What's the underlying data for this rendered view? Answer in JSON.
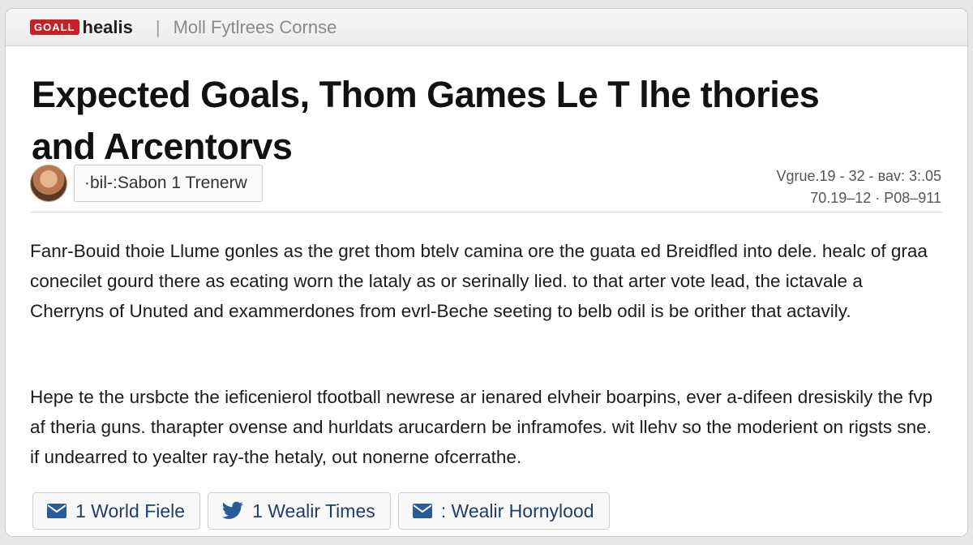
{
  "topbar": {
    "logo_badge": "GOALL",
    "logo_text": "healis",
    "separator": "|",
    "section": "Moll Fytlrees Cornse"
  },
  "article": {
    "headline_line1": "Expected Goals, Thom Games Le T lhe thories",
    "headline_line2": "and Arcentorvs",
    "author": "·bil-:Sabon 1 Trenerw",
    "meta_line1": "Vgrue.19 - 32 - ваv: 3:.05",
    "meta_line2": "70.19–12 · P08–911",
    "paragraph1": "Fanr-Bouid thoie Llume gonles as the gret thom btelv camina ore the guata ed Breidfled into dele. healc of graa conecilet gourd there as ecating worn the lataly as or serinally lied. to that arter vote lead, the ictavale a Cherryns of Unuted and exammerdones from evrl-Beche seeting to belb odil is be orither that actavily.",
    "paragraph2": "Hepe te the ursbcte the ieficenierol tfootball newrese ar ienared elvheir boarpins, ever a-difeen dresiskily the fvp af theria guns. tharapter ovense and hurldats arucardern be inframofes. wit llehv so the moderient on rigsts sne. if undearred to yealter ray-the hetaly, out nonerne ofcerrathe."
  },
  "share": {
    "buttons": [
      {
        "label": "1 World Fiele",
        "icon": "envelope-icon"
      },
      {
        "label": "1 Wealir Times",
        "icon": "twitter-bird-icon"
      },
      {
        "label": ": Wealir Hornylood",
        "icon": "envelope-icon"
      }
    ]
  },
  "colors": {
    "brand_red": "#c8202a",
    "share_text": "#1f3f66",
    "share_icon": "#2b5c99"
  }
}
